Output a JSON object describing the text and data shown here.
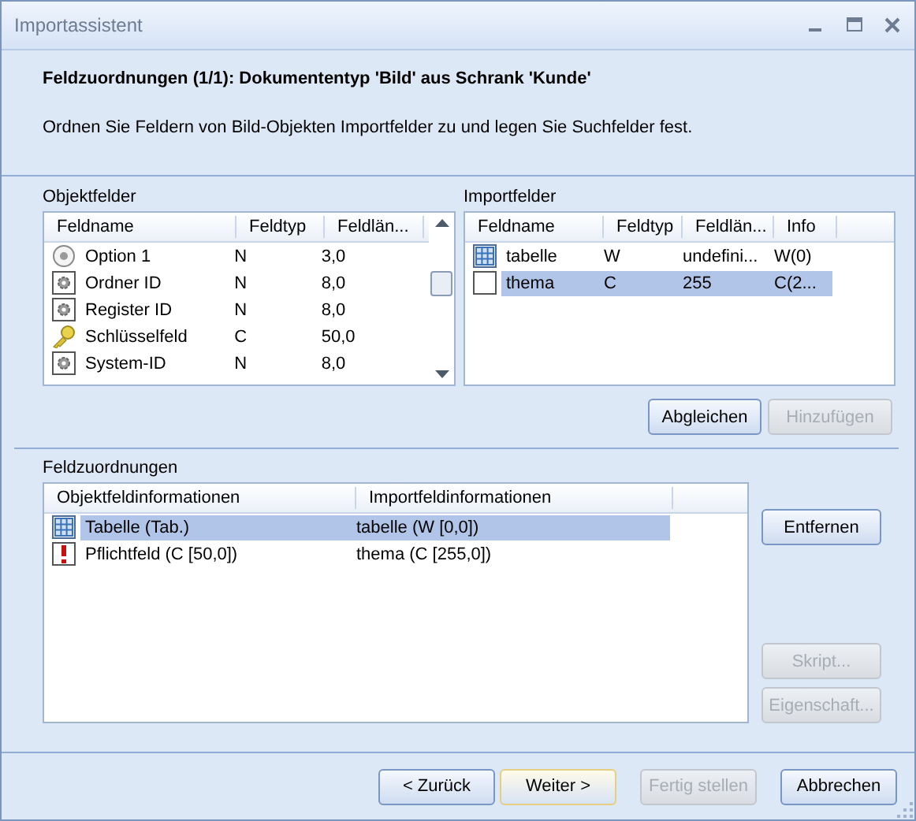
{
  "window": {
    "title": "Importassistent"
  },
  "header": {
    "title": "Feldzuordnungen (1/1): Dokumententyp 'Bild' aus Schrank 'Kunde'",
    "description": "Ordnen Sie Feldern von Bild-Objekten Importfelder zu und legen Sie Suchfelder fest."
  },
  "object_fields": {
    "label": "Objektfelder",
    "columns": [
      "Feldname",
      "Feldtyp",
      "Feldlän..."
    ],
    "rows": [
      {
        "kind": "radio",
        "cells": [
          "Option 1",
          "N",
          "3,0"
        ],
        "selected": false
      },
      {
        "kind": "gear",
        "cells": [
          "Ordner ID",
          "N",
          "8,0"
        ],
        "selected": false
      },
      {
        "kind": "gear",
        "cells": [
          "Register ID",
          "N",
          "8,0"
        ],
        "selected": false
      },
      {
        "kind": "key",
        "cells": [
          "Schlüsselfeld",
          "C",
          "50,0"
        ],
        "selected": false
      },
      {
        "kind": "gear",
        "cells": [
          "System-ID",
          "N",
          "8,0"
        ],
        "selected": false
      }
    ]
  },
  "import_fields": {
    "label": "Importfelder",
    "columns": [
      "Feldname",
      "Feldtyp",
      "Feldlän...",
      "Info"
    ],
    "rows": [
      {
        "kind": "table",
        "cells": [
          "tabelle",
          "W",
          "undefini...",
          "W(0)"
        ],
        "selected": false
      },
      {
        "kind": "blank",
        "cells": [
          "thema",
          "C",
          "255",
          "C(2..."
        ],
        "selected": true
      }
    ],
    "buttons": [
      {
        "label": "Abgleichen",
        "disabled": false
      },
      {
        "label": "Hinzufügen",
        "disabled": true
      }
    ]
  },
  "mappings": {
    "label": "Feldzuordnungen",
    "columns": [
      "Objektfeldinformationen",
      "Importfeldinformationen"
    ],
    "rows": [
      {
        "kind": "table",
        "cells": [
          "Tabelle (Tab.)",
          "tabelle (W [0,0])"
        ],
        "selected": true
      },
      {
        "kind": "required",
        "cells": [
          "Pflichtfeld (C [50,0])",
          "thema (C [255,0])"
        ],
        "selected": false
      }
    ],
    "buttons": [
      {
        "label": "Entfernen",
        "disabled": false
      },
      {
        "label": "Skript...",
        "disabled": true
      },
      {
        "label": "Eigenschaft...",
        "disabled": true
      }
    ]
  },
  "footer_buttons": [
    {
      "label": "< Zurück",
      "disabled": false,
      "highlighted": false
    },
    {
      "label": "Weiter >",
      "disabled": false,
      "highlighted": true
    },
    {
      "label": "Fertig stellen",
      "disabled": true,
      "highlighted": false
    },
    {
      "label": "Abbrechen",
      "disabled": false,
      "highlighted": false
    }
  ]
}
